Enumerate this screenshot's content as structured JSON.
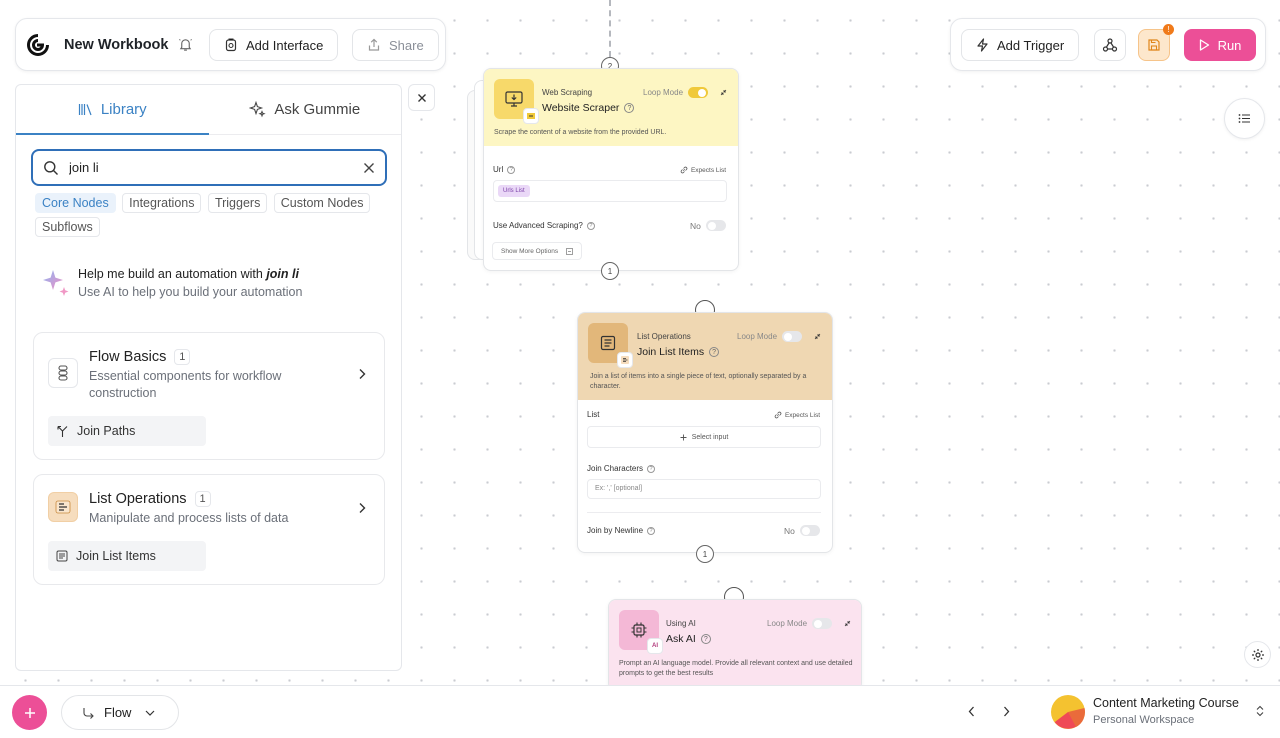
{
  "header": {
    "workbook_title": "New Workbook",
    "add_interface_label": "Add Interface",
    "share_label": "Share"
  },
  "toolbar_right": {
    "add_trigger_label": "Add Trigger",
    "run_label": "Run",
    "save_badge": "!"
  },
  "library": {
    "tabs": [
      {
        "label": "Library",
        "active": true
      },
      {
        "label": "Ask Gummie",
        "active": false
      }
    ],
    "search": {
      "value": "join li",
      "placeholder": ""
    },
    "filters": [
      {
        "label": "Core Nodes",
        "active": true
      },
      {
        "label": "Integrations",
        "active": false
      },
      {
        "label": "Triggers",
        "active": false
      },
      {
        "label": "Custom Nodes",
        "active": false
      },
      {
        "label": "Subflows",
        "active": false
      }
    ],
    "ai_help": {
      "title_prefix": "Help me build an automation with ",
      "title_query": "join li",
      "subtitle": "Use AI to help you build your automation"
    },
    "categories": [
      {
        "title": "Flow Basics",
        "count": "1",
        "description": "Essential components for workflow construction",
        "item": "Join Paths"
      },
      {
        "title": "List Operations",
        "count": "1",
        "description": "Manipulate and process lists of data",
        "item": "Join List Items"
      }
    ]
  },
  "canvas": {
    "top_port_label": "2",
    "nodes": {
      "web_scraper": {
        "category": "Web Scraping",
        "title": "Website Scraper",
        "loop_mode_label": "Loop Mode",
        "loop_mode": true,
        "description": "Scrape the content of a website from the provided URL.",
        "url_label": "Url",
        "expects_list": "Expects List",
        "url_chip": "Urls List",
        "advanced_label": "Use Advanced Scraping?",
        "advanced_value": "No",
        "show_more": "Show More Options",
        "output_port": "1"
      },
      "join_list": {
        "category": "List Operations",
        "title": "Join List Items",
        "loop_mode_label": "Loop Mode",
        "loop_mode": false,
        "description": "Join a list of items into a single piece of text, optionally separated by a character.",
        "list_label": "List",
        "expects_list": "Expects List",
        "select_input": "Select input",
        "join_chars_label": "Join Characters",
        "join_chars_placeholder": "Ex: ',' [optional]",
        "newline_label": "Join by Newline",
        "newline_value": "No",
        "output_port": "1"
      },
      "ask_ai": {
        "category": "Using AI",
        "title": "Ask AI",
        "badge": "AI",
        "loop_mode_label": "Loop Mode",
        "loop_mode": false,
        "description": "Prompt an AI language model. Provide all relevant context and use detailed prompts to get the best results"
      }
    }
  },
  "bottom": {
    "flow_label": "Flow",
    "workspace_name": "Content Marketing Course",
    "workspace_sub": "Personal Workspace"
  },
  "colors": {
    "accent_blue": "#3b82c4",
    "run_pink": "#ec4f97",
    "scraper_yellow": "#fdf6c3",
    "list_tan": "#efd7b2",
    "ai_pink": "#fbe3ef"
  }
}
